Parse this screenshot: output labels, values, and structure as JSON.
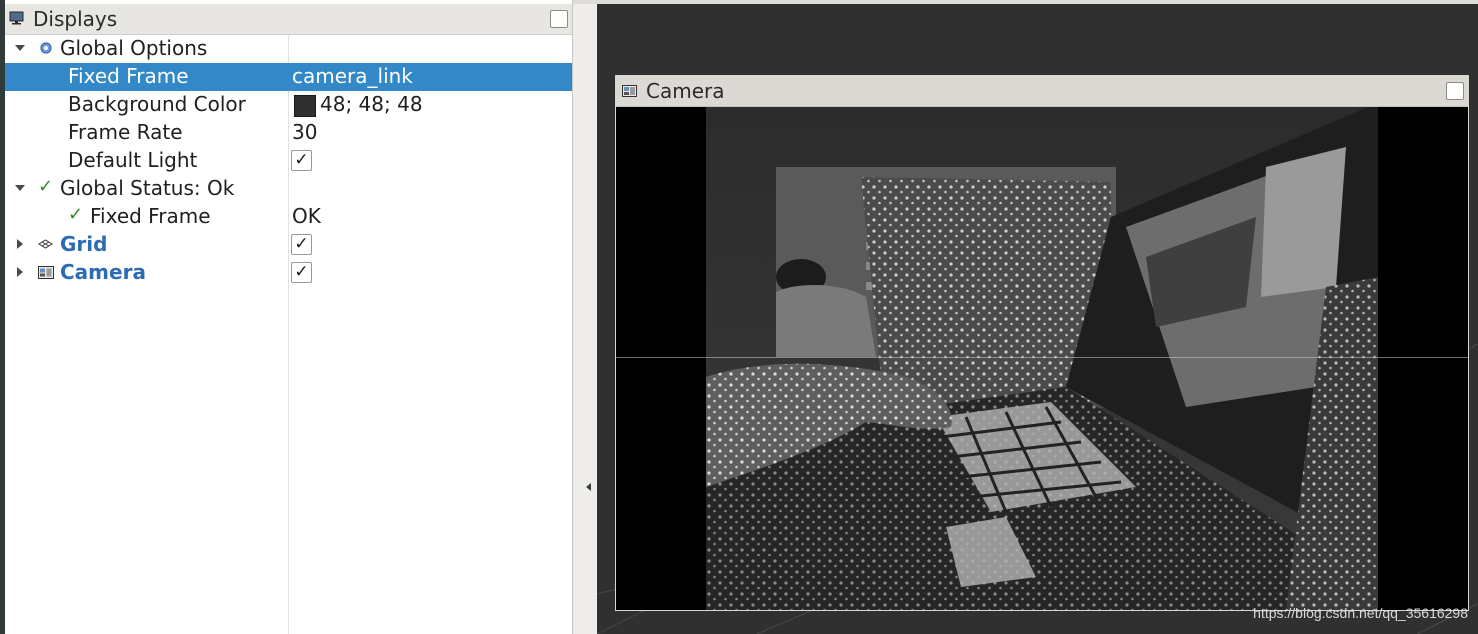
{
  "displays": {
    "title": "Displays",
    "rows": [
      {
        "name": "Global Options",
        "value": ""
      },
      {
        "name": "Fixed Frame",
        "value": "camera_link"
      },
      {
        "name": "Background Color",
        "value": "48; 48; 48"
      },
      {
        "name": "Frame Rate",
        "value": "30"
      },
      {
        "name": "Default Light",
        "value": ""
      },
      {
        "name": "Global Status: Ok",
        "value": ""
      },
      {
        "name": "Fixed Frame",
        "value": "OK"
      },
      {
        "name": "Grid",
        "value": ""
      },
      {
        "name": "Camera",
        "value": ""
      }
    ],
    "checkmark": "✓",
    "checkbox_mark": "✓"
  },
  "camera_panel": {
    "title": "Camera"
  },
  "watermark": "https://blog.csdn.net/qq_35616298",
  "colors": {
    "selection": "#3388c7",
    "highlight_name": "#2c6cb4",
    "status_ok": "#2e8b2e",
    "background_3d": "#303030"
  }
}
